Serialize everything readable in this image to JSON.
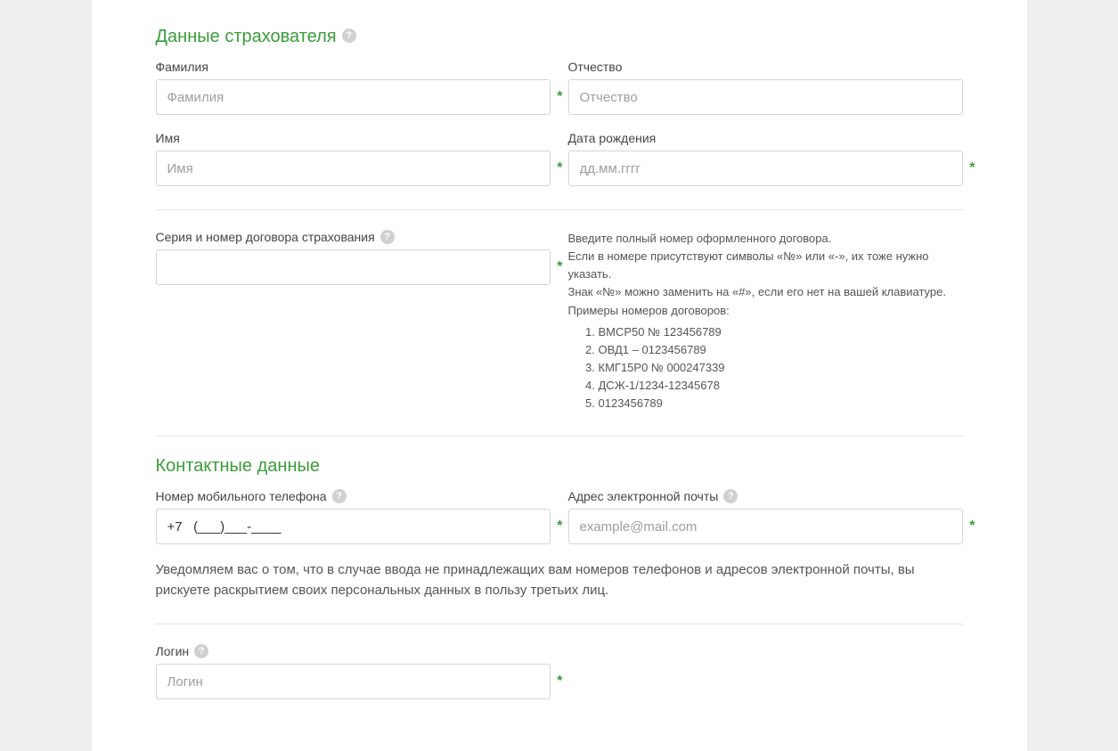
{
  "section_insurer": {
    "title": "Данные страхователя",
    "fields": {
      "lastname": {
        "label": "Фамилия",
        "placeholder": "Фамилия"
      },
      "patronymic": {
        "label": "Отчество",
        "placeholder": "Отчество"
      },
      "firstname": {
        "label": "Имя",
        "placeholder": "Имя"
      },
      "birthdate": {
        "label": "Дата рождения",
        "placeholder": "дд.мм.гггг"
      }
    }
  },
  "contract": {
    "label": "Серия и номер договора страхования",
    "hint_intro": "Введите полный номер оформленного договора.",
    "hint_symbols": "Если в номере присутствуют символы «№» или «-», их тоже нужно указать.",
    "hint_replace": "Знак «№» можно заменить на «#», если его нет на вашей клавиатуре.",
    "examples_title": "Примеры номеров договоров:",
    "examples": [
      "ВМСР50 № 123456789",
      "ОВД1 – 0123456789",
      "КМГ15Р0 № 000247339",
      "ДСЖ-1/1234-12345678",
      "0123456789"
    ]
  },
  "section_contact": {
    "title": "Контактные данные",
    "fields": {
      "phone": {
        "label": "Номер мобильного телефона",
        "value": "+7   (___)___-____"
      },
      "email": {
        "label": "Адрес электронной почты",
        "placeholder": "example@mail.com"
      }
    },
    "disclaimer": "Уведомляем вас о том, что в случае ввода не принадлежащих вам номеров телефонов и адресов электронной почты, вы рискуете раскрытием своих персональных данных в пользу третьих лиц.",
    "login": {
      "label": "Логин",
      "placeholder": "Логин"
    }
  }
}
